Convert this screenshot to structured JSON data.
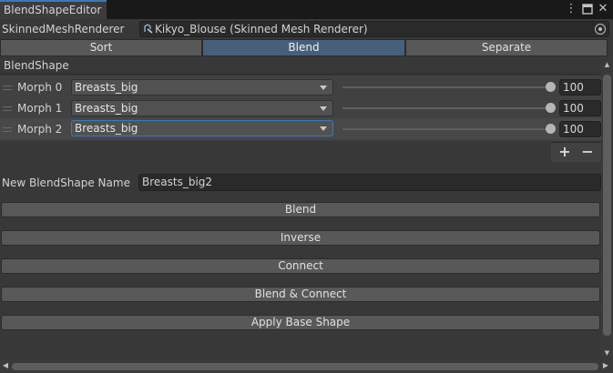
{
  "window": {
    "tab_title": "BlendShapeEditor"
  },
  "renderer": {
    "label": "SkinnedMeshRenderer",
    "value": "Kikyo_Blouse (Skinned Mesh Renderer)"
  },
  "modes": [
    {
      "label": "Sort",
      "active": false
    },
    {
      "label": "Blend",
      "active": true
    },
    {
      "label": "Separate",
      "active": false
    }
  ],
  "blendshape_list": {
    "header": "BlendShape",
    "rows": [
      {
        "label": "Morph 0",
        "shape": "Breasts_big",
        "weight": "100"
      },
      {
        "label": "Morph 1",
        "shape": "Breasts_big",
        "weight": "100"
      },
      {
        "label": "Morph 2",
        "shape": "Breasts_big",
        "weight": "100"
      }
    ],
    "add_label": "+",
    "remove_label": "−"
  },
  "new_name": {
    "label": "New BlendShape Name",
    "value": "Breasts_big2"
  },
  "actions": [
    "Blend",
    "Inverse",
    "Connect",
    "Blend & Connect",
    "Apply Base Shape"
  ],
  "colors": {
    "accent": "#3a79bb",
    "active_tab": "#46607c",
    "background": "#383838"
  },
  "icons": [
    "menu-dots-icon",
    "maximize-icon",
    "close-icon",
    "object-picker-icon",
    "mesh-renderer-icon"
  ]
}
